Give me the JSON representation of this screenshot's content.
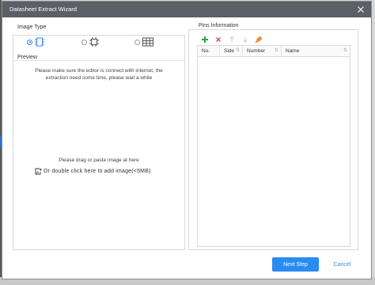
{
  "window": {
    "title": "Datasheet Extract Wizard"
  },
  "image_type": {
    "label": "Image Type",
    "options": [
      {
        "name": "chip-icon",
        "selected": true
      },
      {
        "name": "component-icon",
        "selected": false
      },
      {
        "name": "table-icon",
        "selected": false
      }
    ]
  },
  "preview": {
    "label": "Preview",
    "notice_line1": "Please make sure the editor is connect with internet, the",
    "notice_line2": "extraction need some time, please wait a while",
    "drop_hint": "Please drag or paste image at here",
    "upload_text": "Or double click here to add image(<5MB)"
  },
  "pins": {
    "label": "Pins Information",
    "toolbar": [
      {
        "name": "add-icon",
        "color": "#2ea043"
      },
      {
        "name": "delete-icon",
        "color": "#e5484d"
      },
      {
        "name": "move-up-icon",
        "color": "#c7d7f2"
      },
      {
        "name": "move-down-icon",
        "color": "#c7d7f2"
      },
      {
        "name": "clear-icon",
        "color": "#f08c2e"
      }
    ],
    "columns": [
      "No.",
      "Side",
      "Number",
      "Name"
    ]
  },
  "buttons": {
    "next": "Next Step",
    "cancel": "Cancel"
  },
  "colors": {
    "accent": "#2a8cf0",
    "titlebar": "#5b5f66"
  }
}
